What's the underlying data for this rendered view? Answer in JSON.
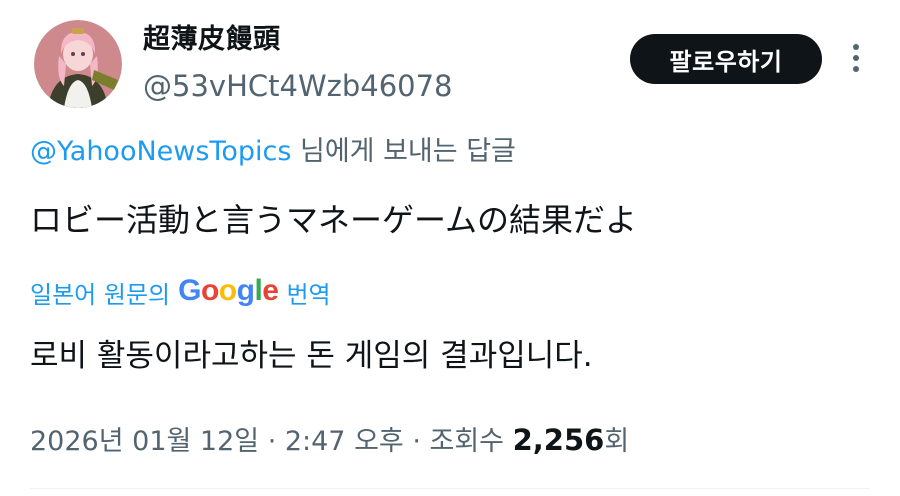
{
  "header": {
    "display_name": "超薄皮饅頭",
    "handle": "@53vHCt4Wzb46078",
    "follow_label": "팔로우하기"
  },
  "reply": {
    "mention": "@YahooNewsTopics",
    "suffix": " 님에게 보내는 답글"
  },
  "tweet": {
    "text": "ロビー活動と言うマネーゲームの結果だよ"
  },
  "translate": {
    "prefix": "일본어 원문의",
    "google": [
      "G",
      "o",
      "o",
      "g",
      "l",
      "e"
    ],
    "suffix": "번역"
  },
  "translation": {
    "text": "로비 활동이라고하는 돈 게임의 결과입니다."
  },
  "meta": {
    "timestamp": "2026년 01월 12일 · 2:47 오후 · 조회수 ",
    "views": "2,256",
    "views_suffix": "회"
  },
  "icons": {
    "more": "more-vertical-icon",
    "avatar": "avatar-image"
  },
  "colors": {
    "accent": "#1d9bf0",
    "text": "#0f1419",
    "secondary": "#536471",
    "button_bg": "#0f1419"
  }
}
